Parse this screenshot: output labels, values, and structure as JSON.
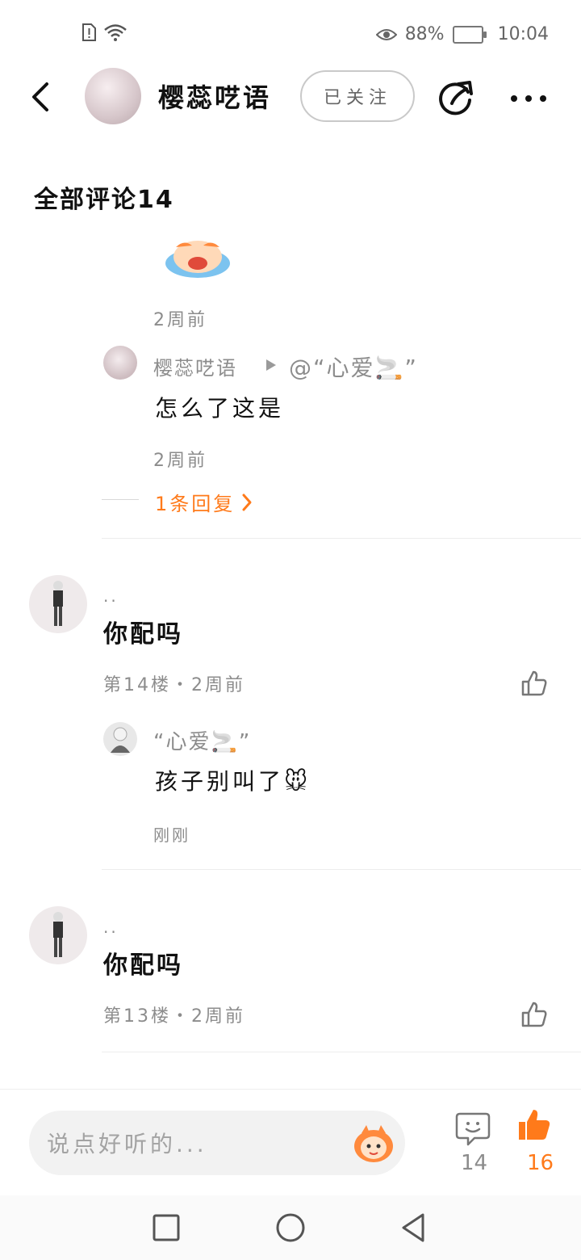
{
  "status": {
    "battery_percent": "88%",
    "time": "10:04"
  },
  "header": {
    "author_name": "樱蕊呓语",
    "follow_label": "已关注"
  },
  "section": {
    "title": "全部评论14"
  },
  "thread1": {
    "time_top": "2周前",
    "reply": {
      "from": "樱蕊呓语",
      "to": "@“心爱🚬”",
      "text": "怎么了这是",
      "time": "2周前"
    },
    "more_replies": "1条回复"
  },
  "comments": [
    {
      "user": "..",
      "text": "你配吗",
      "meta": "第14楼・2周前",
      "reply": {
        "user": "“心爱🚬”",
        "text": "孩子别叫了🐭",
        "time": "刚刚"
      }
    },
    {
      "user": "..",
      "text": "你配吗",
      "meta": "第13楼・2周前"
    }
  ],
  "bottom": {
    "input_placeholder": "说点好听的...",
    "comment_count": "14",
    "like_count": "16"
  },
  "colors": {
    "accent": "#ff7a1a",
    "text": "#111111",
    "muted": "#8c8c8c"
  }
}
